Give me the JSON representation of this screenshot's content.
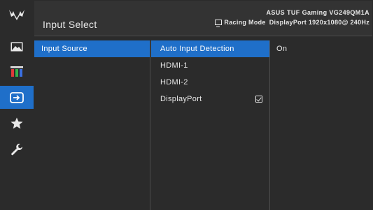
{
  "header": {
    "title": "Input Select",
    "model": "ASUS TUF Gaming VG249QM1A",
    "mode": "Racing Mode",
    "input_info": "DisplayPort 1920x1080@ 240Hz"
  },
  "sidebar": {
    "items": [
      {
        "icon": "image-icon",
        "label": ""
      },
      {
        "icon": "color-icon",
        "label": ""
      },
      {
        "icon": "input-select-icon",
        "label": "",
        "active": true
      },
      {
        "icon": "star-icon",
        "label": ""
      },
      {
        "icon": "wrench-icon",
        "label": ""
      }
    ],
    "logo": "tuf-logo"
  },
  "menu": {
    "level1": [
      "Input Source"
    ],
    "level2": [
      "Auto Input Detection",
      "HDMI-1",
      "HDMI-2",
      "DisplayPort"
    ],
    "level3": [
      "On"
    ],
    "checked_item": "DisplayPort"
  },
  "colors": {
    "accent": "#1f6fc9",
    "background": "#2b2b2b"
  }
}
